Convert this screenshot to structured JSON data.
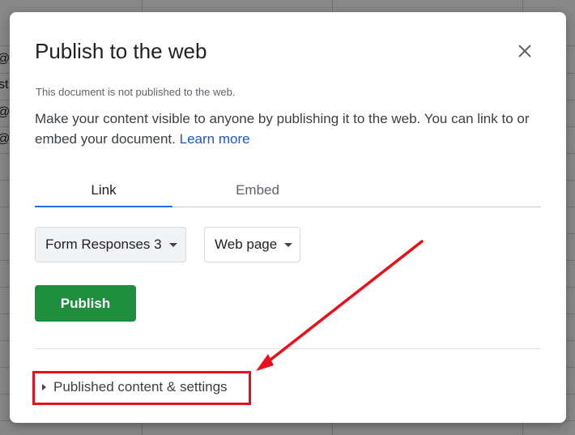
{
  "dialog": {
    "title": "Publish to the web",
    "status": "This document is not published to the web.",
    "description": "Make your content visible to anyone by publishing it to the web. You can link to or embed your document.",
    "learn_more": "Learn more",
    "close_icon": "close-icon"
  },
  "tabs": [
    {
      "label": "Link",
      "active": true
    },
    {
      "label": "Embed",
      "active": false
    }
  ],
  "selects": {
    "sheet": "Form Responses 3",
    "format": "Web page"
  },
  "publish_button": "Publish",
  "settings_toggle": "Published content & settings",
  "colors": {
    "publish_green": "#1e8e3e",
    "link_blue": "#1a57c7",
    "tab_indicator": "#1a73e8",
    "annotation_red": "#e8101a"
  },
  "background_sheet": {
    "cells": [
      "@g",
      "st",
      "@g",
      "@g"
    ]
  }
}
